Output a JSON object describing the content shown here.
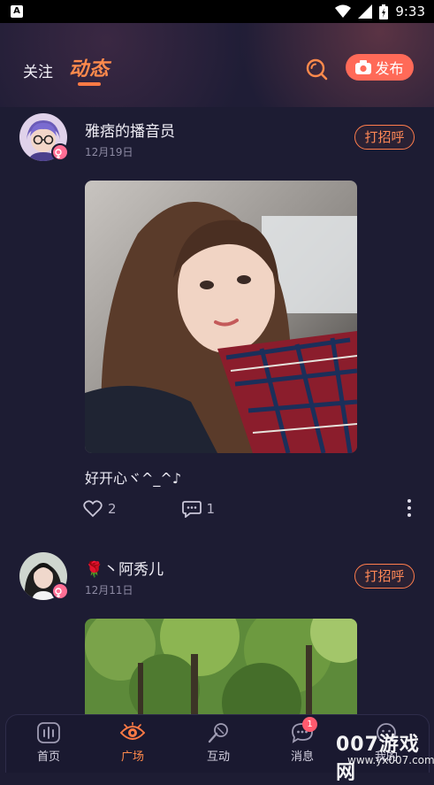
{
  "status_bar": {
    "time": "9:33"
  },
  "header": {
    "tab_follow": "关注",
    "tab_feed": "动态",
    "publish_label": "发布"
  },
  "posts": [
    {
      "username": "雅痞的播音员",
      "date": "12月19日",
      "greet": "打招呼",
      "caption": "好开心ヾ^_^♪",
      "likes": "2",
      "comments": "1"
    },
    {
      "username": "🌹丶阿秀儿",
      "date": "12月11日",
      "greet": "打招呼"
    }
  ],
  "nav": {
    "home": "首页",
    "square": "广场",
    "interact": "互动",
    "messages": "消息",
    "messages_badge": "1",
    "mine": "我的"
  },
  "watermark": {
    "main": "007游戏网",
    "sub": "www.yx007.com"
  },
  "colors": {
    "accent": "#ff7a45",
    "background": "#1d1c33",
    "publish": "#ff6a58"
  }
}
